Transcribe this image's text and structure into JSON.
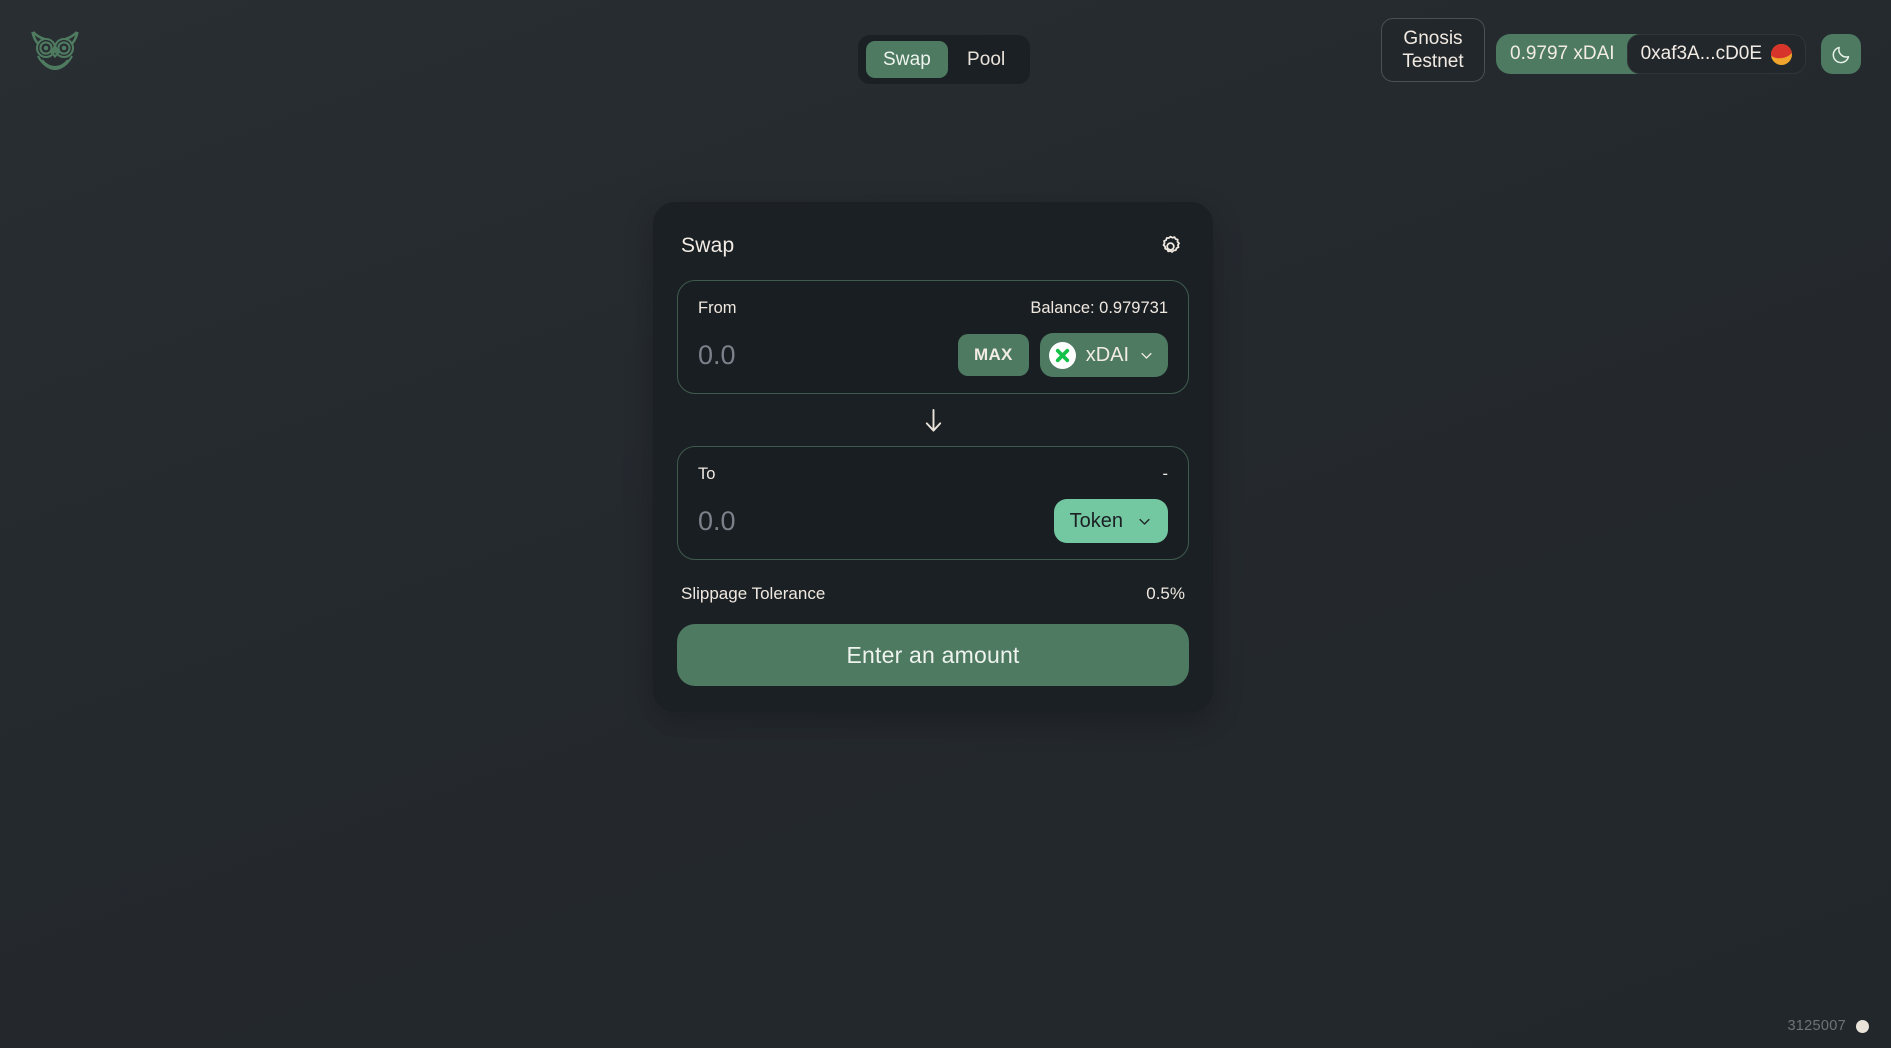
{
  "app": {
    "logo_icon": "owl-logo-icon",
    "accent_green": "#4d7a61",
    "accent_mint": "#73c7a1",
    "card_bg": "#1b2024",
    "page_bg": "#24292e"
  },
  "nav": {
    "tabs": [
      {
        "label": "Swap",
        "active": true
      },
      {
        "label": "Pool",
        "active": false
      }
    ]
  },
  "wallet": {
    "network": "Gnosis Testnet",
    "network_line1": "Gnosis",
    "network_line2": "Testnet",
    "balance": "0.9797 xDAI",
    "address": "0xaf3A...cD0E",
    "avatar_icon": "jazzicon-avatar",
    "theme_toggle_icon": "moon-icon"
  },
  "swap": {
    "title": "Swap",
    "settings_icon": "gear-icon",
    "arrow_icon": "arrow-down-icon",
    "from": {
      "label": "From",
      "balance_label": "Balance: 0.979731",
      "amount_value": "",
      "amount_placeholder": "0.0",
      "max_label": "MAX",
      "token_symbol": "xDAI",
      "token_icon": "gnosis-xdai-icon",
      "chevron_icon": "chevron-down-icon"
    },
    "to": {
      "label": "To",
      "balance_label": "-",
      "amount_value": "",
      "amount_placeholder": "0.0",
      "token_symbol": "Token",
      "chevron_icon": "chevron-down-icon"
    },
    "slippage": {
      "label": "Slippage Tolerance",
      "value": "0.5%"
    },
    "action_label": "Enter an amount"
  },
  "footer": {
    "block_number": "3125007",
    "status_icon": "status-dot-icon"
  }
}
